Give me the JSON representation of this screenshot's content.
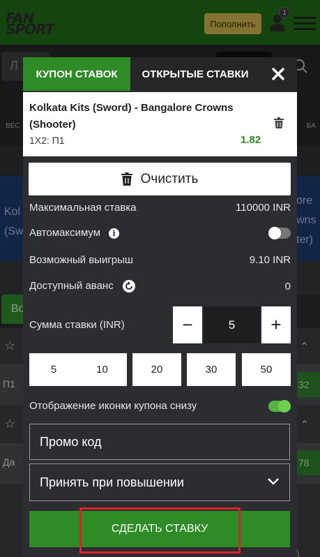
{
  "header": {
    "logo_text": "FAN SPORT",
    "topup_label": "Пополнить",
    "notification_count": "1"
  },
  "background": {
    "search_placeholder_fragment": "Л",
    "nav_left_fragment": "ВЕС",
    "nav_right_fragment": "БА",
    "banner_left_line1": "Kol",
    "banner_left_line2": "(Sw",
    "banner_right_line1": "ore",
    "banner_right_line2": "wns",
    "banner_right_line3": "ter)",
    "tab_fragment": "Во",
    "row1_label": "П1",
    "row1_odd": "32",
    "row2_label": "Да",
    "row2_odd": "78"
  },
  "coupon": {
    "tab_active": "КУПОН СТАВОК",
    "tab_open": "ОТКРЫТЫЕ СТАВКИ",
    "bet": {
      "title": "Kolkata Kits (Sword) - Bangalore Crowns (Shooter)",
      "market": "1X2: П1",
      "odd": "1.82"
    },
    "clear_label": "Очистить",
    "max_stake_label": "Максимальная ставка",
    "max_stake_value": "110000 INR",
    "automax_label": "Автомаксимум",
    "automax_enabled": false,
    "possible_win_label": "Возможный выигрыш",
    "possible_win_value": "9.10 INR",
    "advance_label": "Доступный аванс",
    "advance_value": "0",
    "stake_label": "Сумма ставки (INR)",
    "stake_value": "5",
    "minus_label": "−",
    "plus_label": "+",
    "quick_stakes": [
      "5",
      "10",
      "20",
      "30",
      "50"
    ],
    "show_icon_label": "Отображение иконки купона снизу",
    "show_icon_enabled": true,
    "promo_placeholder": "Промо код",
    "accept_label": "Принять при повышении",
    "place_bet_label": "СДЕЛАТЬ СТАВКУ"
  },
  "colors": {
    "accent_green": "#2e8b25",
    "highlight_red": "#e0202a",
    "topup_gold": "#c9b04a"
  }
}
